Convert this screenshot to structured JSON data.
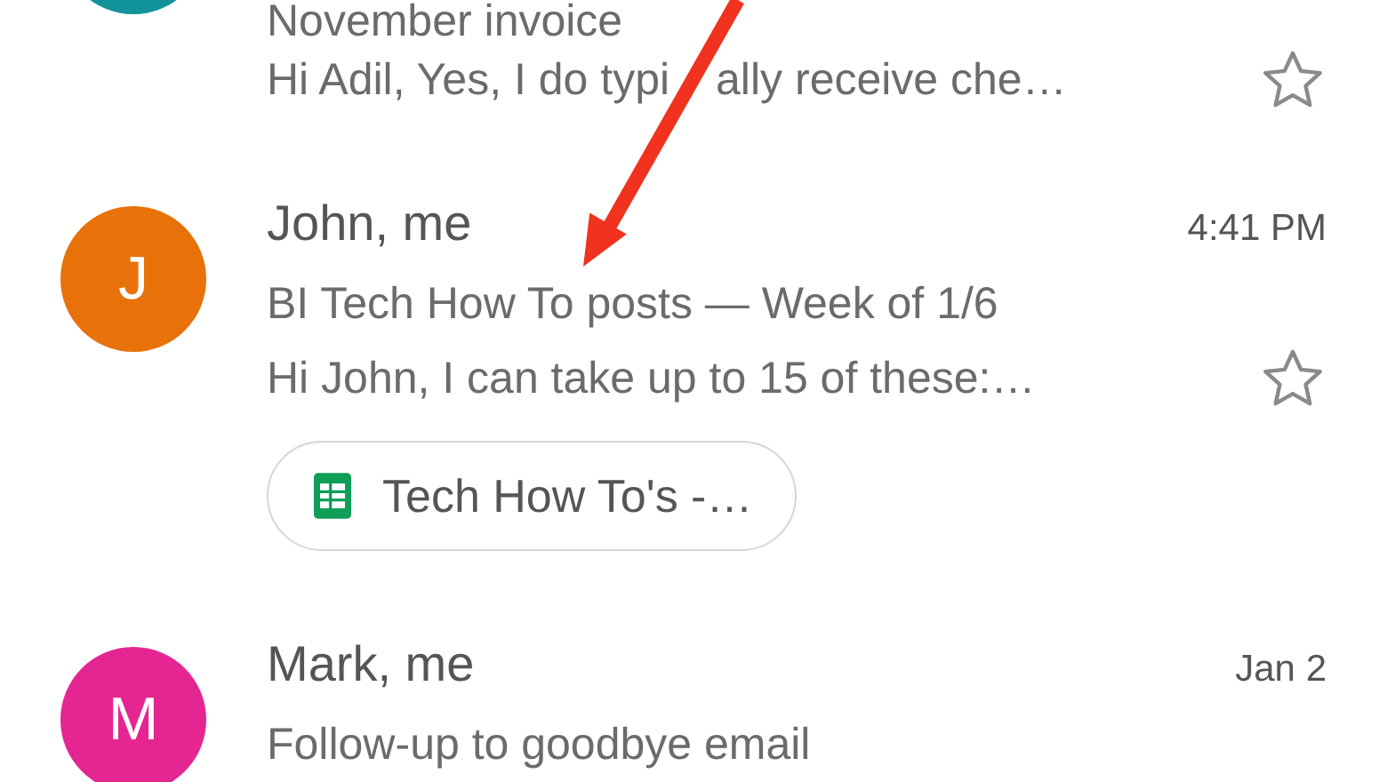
{
  "emails": [
    {
      "subject": "November invoice",
      "preview_parts": [
        "Hi Adil, Yes, I do typi",
        "ally receive che…"
      ],
      "starred": false,
      "color": "#12939a"
    },
    {
      "initial": "J",
      "sender": "John, me",
      "time": "4:41 PM",
      "subject": "BI Tech How To posts — Week of 1/6",
      "preview": "Hi John, I can take up to 15 of these:…",
      "starred": false,
      "attachment": "Tech How To's -…",
      "color": "#e8710a"
    },
    {
      "initial": "M",
      "sender": "Mark, me",
      "time": "Jan 2",
      "subject": "Follow-up to goodbye email",
      "color": "#e52592"
    }
  ]
}
